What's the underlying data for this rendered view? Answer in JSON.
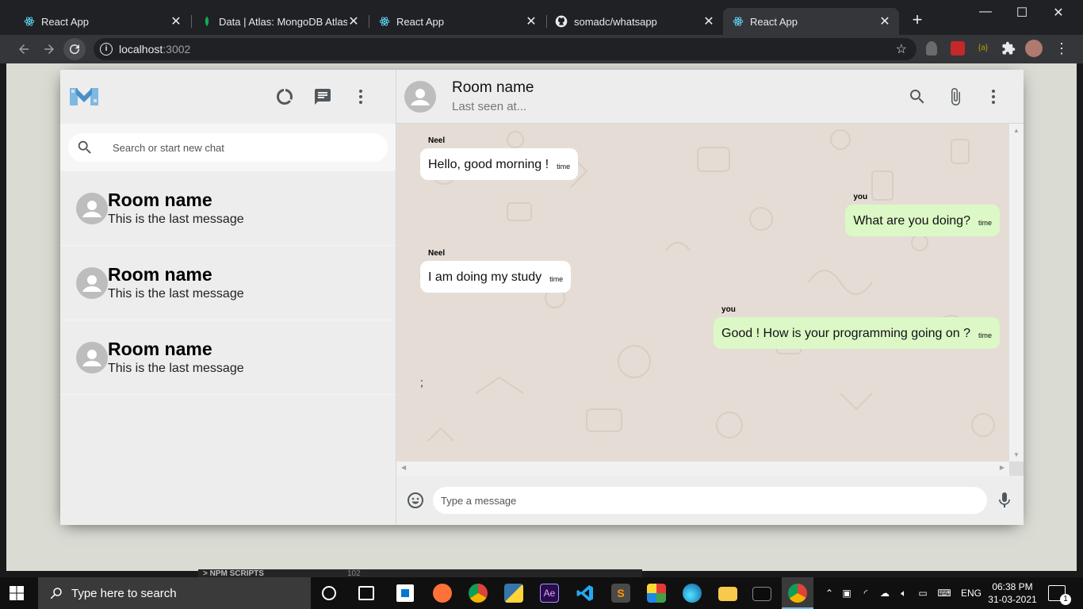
{
  "browser": {
    "tabs": [
      {
        "label": "React App",
        "icon": "react-icon",
        "active": false
      },
      {
        "label": "Data | Atlas: MongoDB Atlas",
        "icon": "mongodb-leaf-icon",
        "active": false
      },
      {
        "label": "React App",
        "icon": "react-icon",
        "active": false
      },
      {
        "label": "somadc/whatsapp",
        "icon": "github-icon",
        "active": false
      },
      {
        "label": "React App",
        "icon": "react-icon",
        "active": true
      }
    ],
    "url_host": "localhost",
    "url_port": ":3002"
  },
  "sidebar": {
    "search_placeholder": "Search or start new chat",
    "chats": [
      {
        "name": "Room name",
        "last_message": "This is the last message"
      },
      {
        "name": "Room name",
        "last_message": "This is the last message"
      },
      {
        "name": "Room name",
        "last_message": "This is the last message"
      }
    ]
  },
  "chat": {
    "title": "Room name",
    "subtitle": "Last seen at...",
    "messages": [
      {
        "sender": "Neel",
        "text": "Hello, good morning !",
        "time": "time",
        "sent": false
      },
      {
        "sender": "you",
        "text": "What are you doing?",
        "time": "time",
        "sent": true
      },
      {
        "sender": "Neel",
        "text": "I am doing my study",
        "time": "time",
        "sent": false
      },
      {
        "sender": "you",
        "text": "Good ! How is your programming going on ?",
        "time": "time",
        "sent": true
      }
    ],
    "stray_text": ";",
    "input_placeholder": "Type a message"
  },
  "taskbar": {
    "search_placeholder": "Type here to search",
    "language": "ENG",
    "time": "06:38 PM",
    "date": "31-03-2021",
    "notification_count": "1"
  },
  "vscode_strip": {
    "label": "> NPM SCRIPTS",
    "number": "102"
  },
  "colors": {
    "sent_bubble": "#dcf8c6",
    "received_bubble": "#ffffff",
    "chat_background": "#e5ddd5",
    "panel": "#ededed"
  }
}
